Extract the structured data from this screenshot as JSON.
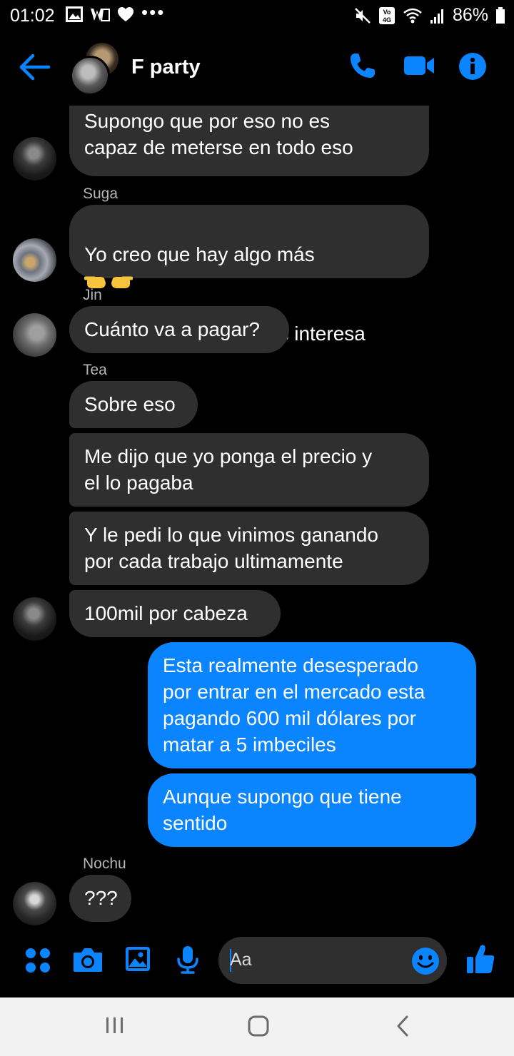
{
  "status_bar": {
    "time": "01:02",
    "overflow_dots": "•••",
    "battery": "86%",
    "network_badge_top": "Vo",
    "network_badge_bottom": "4G"
  },
  "header": {
    "title": "F party",
    "accent_color": "#0a84ff"
  },
  "messages": [
    {
      "sender": "",
      "direction": "in",
      "text": "esposa y una hija recien nacida.\nSupongo que por eso no es\ncapaz de meterse en todo eso"
    },
    {
      "sender": "Suga",
      "direction": "in",
      "text": "Yo creo que hay algo más",
      "text2": "pero bueno eso no nos interesa",
      "emoji": "point-right-left-emoji"
    },
    {
      "sender": "Jin",
      "direction": "in",
      "text": "Cuánto va a pagar?"
    },
    {
      "sender": "Tea",
      "direction": "in",
      "text": "Sobre eso"
    },
    {
      "sender": "",
      "direction": "in",
      "text": "Me dijo que yo ponga el precio y\nel lo pagaba"
    },
    {
      "sender": "",
      "direction": "in",
      "text": "Y le pedi lo que vinimos ganando\npor cada trabajo ultimamente"
    },
    {
      "sender": "",
      "direction": "in",
      "text": "100mil por cabeza"
    },
    {
      "sender": "",
      "direction": "out",
      "text": "Esta realmente desesperado\npor entrar en el mercado esta\npagando 600 mil dólares por\nmatar a 5 imbeciles"
    },
    {
      "sender": "",
      "direction": "out",
      "text": "Aunque supongo que tiene\nsentido"
    },
    {
      "sender": "Nochu",
      "direction": "in",
      "text": "???"
    }
  ],
  "composer": {
    "placeholder": "Aa"
  },
  "colors": {
    "incoming_bubble": "#2f2f2f",
    "outgoing_bubble": "#0a84ff",
    "background": "#000000"
  }
}
